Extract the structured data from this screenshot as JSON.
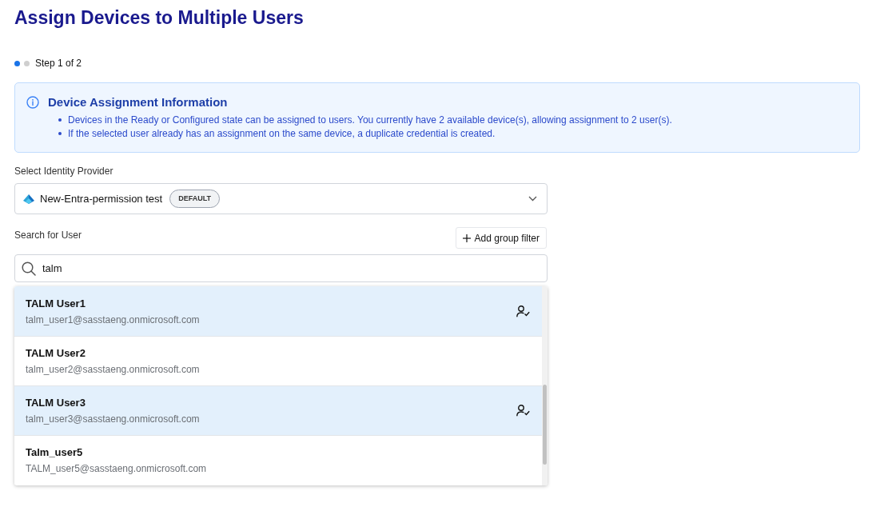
{
  "page": {
    "title": "Assign Devices to Multiple Users"
  },
  "stepper": {
    "steps": [
      {
        "selected": true
      },
      {
        "selected": false
      }
    ],
    "label": "Step 1 of 2"
  },
  "info": {
    "title": "Device Assignment Information",
    "items": [
      "Devices in the Ready or Configured state can be assigned to users. You currently have 2 available device(s), allowing assignment to 2 user(s).",
      "If the selected user already has an assignment on the same device, a duplicate credential is created."
    ]
  },
  "identity_provider": {
    "label": "Select Identity Provider",
    "value": "New-Entra-permission test",
    "badge": "DEFAULT"
  },
  "user_search": {
    "label": "Search for User",
    "add_filter_button": "Add group filter",
    "value": "talm"
  },
  "results": [
    {
      "name": "TALM User1",
      "email": "talm_user1@sasstaeng.onmicrosoft.com",
      "selected": true
    },
    {
      "name": "TALM User2",
      "email": "talm_user2@sasstaeng.onmicrosoft.com",
      "selected": false
    },
    {
      "name": "TALM User3",
      "email": "talm_user3@sasstaeng.onmicrosoft.com",
      "selected": true
    },
    {
      "name": "Talm_user5",
      "email": "TALM_user5@sasstaeng.onmicrosoft.com",
      "selected": false
    }
  ]
}
